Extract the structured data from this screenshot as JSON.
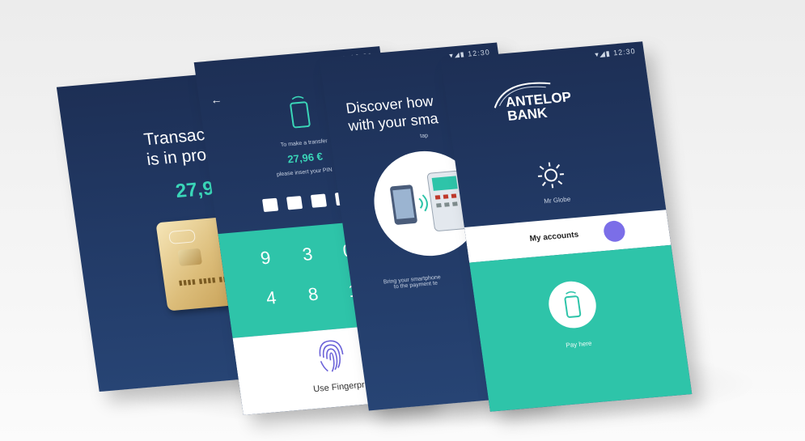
{
  "status": {
    "time": "12:30",
    "icons": "▾◢▮"
  },
  "screen1": {
    "title_line1": "Transact",
    "title_line2": "is in prog",
    "amount": "27,96"
  },
  "screen2": {
    "back": "←",
    "caption1": "To make a transfer",
    "amount": "27,96 €",
    "caption2": "please insert your PIN",
    "keys": [
      "9",
      "3",
      "0",
      "4",
      "8",
      "1"
    ],
    "fingerprint_label": "Use Fingerpr"
  },
  "screen3": {
    "title_line1": "Discover how",
    "title_line2": "with your sma",
    "sub": "tap",
    "caption_line1": "Bring your smartphone",
    "caption_line2": "to the payment te"
  },
  "screen4": {
    "logo_line1": "ANTELOP",
    "logo_line2": "BANK",
    "weather": "Mr Globe",
    "accounts": "My accounts",
    "pay_label": "Pay here"
  },
  "colors": {
    "navy": "#1d2f55",
    "teal": "#2ec4a9",
    "accent_teal": "#3ad6b8",
    "white": "#ffffff",
    "purple": "#7b6ee8"
  }
}
